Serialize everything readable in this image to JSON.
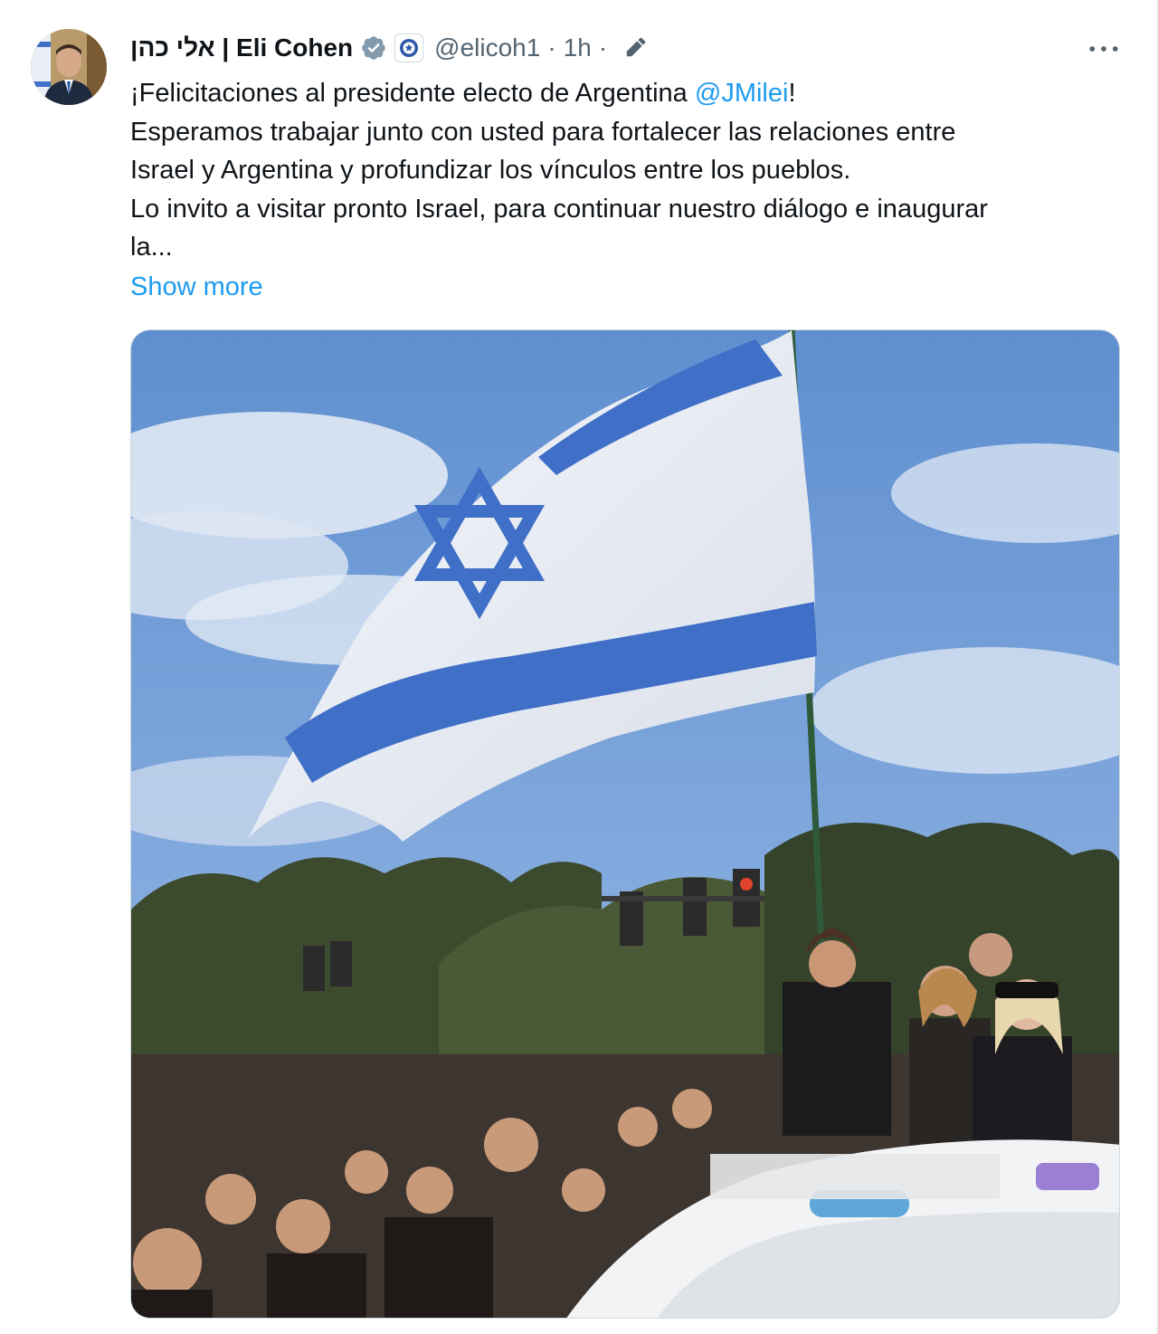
{
  "tweet": {
    "display_name": "אלי כהן | Eli Cohen",
    "handle": "@elicoh1",
    "separator": "·",
    "time": "1h",
    "separator2": "·",
    "text_line1_prefix": "¡Felicitaciones al presidente electo de Argentina ",
    "text_line1_mention": "@JMilei",
    "text_line1_suffix": "!",
    "text_line2": "Esperamos trabajar junto con usted para fortalecer las relaciones entre",
    "text_line3": "Israel y Argentina y profundizar los vínculos entre los pueblos.",
    "text_line4": "Lo invito a visitar pronto Israel, para continuar nuestro diálogo e inaugurar",
    "text_line5": "la...",
    "show_more_label": "Show more"
  },
  "icons": {
    "verified": "verified-badge-icon",
    "affiliate": "government-affiliate-icon",
    "edit": "edited-pencil-icon",
    "more": "more-options-icon"
  },
  "colors": {
    "link": "#1d9bf0",
    "secondary_text": "#536471",
    "verified_badge": "#829aab",
    "flag_blue": "#3f6fc6"
  }
}
